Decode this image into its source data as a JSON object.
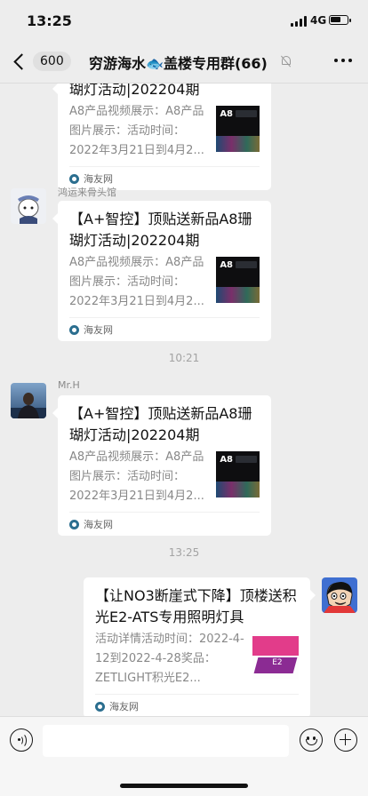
{
  "status_bar": {
    "time": "13:25",
    "network": "4G"
  },
  "nav": {
    "back_count": "600",
    "title_prefix": "穷游海水",
    "title_emoji": "🐟",
    "title_suffix": "盖楼专用群(66)"
  },
  "messages": [
    {
      "id": "m1",
      "sender": "",
      "card_title": "瑚灯活动|202204期",
      "description": "A8产品视频展示：A8产品图片展示：活动时间：2022年3月21日到4月2...",
      "thumb_label": "A8",
      "source": "海友网"
    },
    {
      "id": "m2",
      "sender": "鸿运来骨头馆",
      "card_title": "【A+智控】顶贴送新品A8珊瑚灯活动|202204期",
      "description": "A8产品视频展示：A8产品图片展示：活动时间：2022年3月21日到4月2...",
      "thumb_label": "A8",
      "source": "海友网"
    },
    {
      "id": "m3",
      "sender": "Mr.H",
      "card_title": "【A+智控】顶贴送新品A8珊瑚灯活动|202204期",
      "description": "A8产品视频展示：A8产品图片展示：活动时间：2022年3月21日到4月2...",
      "thumb_label": "A8",
      "source": "海友网"
    },
    {
      "id": "m4",
      "sender": "",
      "card_title": "【让NO3断崖式下降】顶楼送积光E2-ATS专用照明灯具",
      "description": "活动详情活动时间：2022-4-12到2022-4-28奖品：ZETLIGHT积光E2...",
      "thumb_label": "E2",
      "source": "海友网"
    }
  ],
  "timestamps": [
    "10:21",
    "13:25"
  ],
  "colors": {
    "background": "#ededed",
    "card": "#ffffff",
    "source_icon": "#2b6e8f"
  }
}
